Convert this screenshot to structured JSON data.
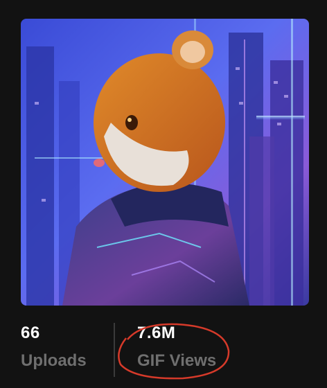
{
  "profile": {
    "avatar_icon": "hamster-cyberpunk-avatar"
  },
  "stats": {
    "uploads": {
      "value": "66",
      "label": "Uploads"
    },
    "views": {
      "value": "7.6M",
      "label": "GIF Views"
    }
  },
  "colors": {
    "background": "#121212",
    "value_text": "#ffffff",
    "label_text": "#6f6f6f",
    "highlight_circle": "#d63a2a"
  }
}
